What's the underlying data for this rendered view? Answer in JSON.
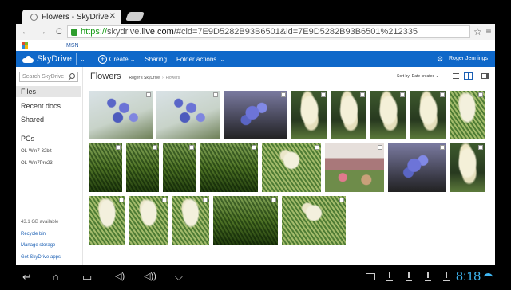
{
  "browser": {
    "tab_title": "Flowers - SkyDrive",
    "tab_close": "✕",
    "url_scheme": "https://",
    "url_sub": "skydrive.",
    "url_host": "live.com",
    "url_rest": "/#cid=7E9D5282B93B6501&id=7E9D5282B93B6501%212335",
    "back_icon": "←",
    "forward_icon": "→",
    "reload_icon": "C",
    "star_icon": "☆",
    "menu_icon": "≡",
    "bookmark_msn": "MSN"
  },
  "header": {
    "app_name": "SkyDrive",
    "chevron": "⌄",
    "create_label": "Create",
    "create_chev": "⌄",
    "sharing_label": "Sharing",
    "folder_actions_label": "Folder actions",
    "folder_actions_chev": "⌄",
    "gear": "⚙",
    "username": "Roger Jennings"
  },
  "sidebar": {
    "search_placeholder": "Search SkyDrive",
    "items": [
      {
        "label": "Files"
      },
      {
        "label": "Recent docs"
      },
      {
        "label": "Shared"
      }
    ],
    "pcs_heading": "PCs",
    "pcs": [
      {
        "label": "OL-Win7-32bit"
      },
      {
        "label": "OL-Win7Pro23"
      }
    ],
    "storage_text": "43.1 GB available",
    "links": [
      {
        "label": "Recycle bin"
      },
      {
        "label": "Manage storage"
      },
      {
        "label": "Get SkyDrive apps"
      }
    ]
  },
  "content": {
    "folder_title": "Flowers",
    "breadcrumb_root": "Roger's SkyDrive",
    "breadcrumb_sep": "›",
    "breadcrumb_current": "Flowers",
    "sort_label": "Sort by: Date created",
    "sort_chev": "⌄"
  },
  "android": {
    "back": "↩",
    "home": "⌂",
    "recents": "▭",
    "vol_down": "◁)",
    "vol_up": "◁))",
    "collapse": "⌵",
    "clock": "8:18"
  },
  "colors": {
    "accent": "#0f68c9",
    "link": "#1a5fb4",
    "clock": "#3fb6f2"
  }
}
